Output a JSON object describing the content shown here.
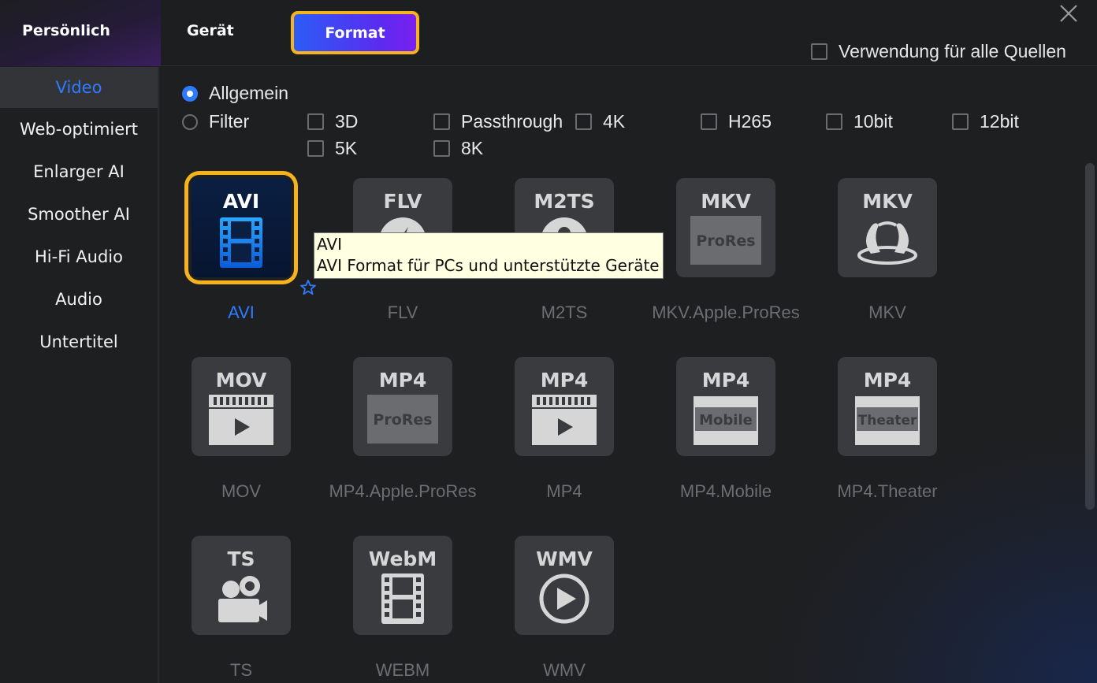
{
  "header": {
    "tabs": [
      {
        "label": "Persönlich"
      },
      {
        "label": "Gerät"
      },
      {
        "label": "Format"
      }
    ],
    "apply_all_label": "Verwendung für alle Quellen"
  },
  "sidebar": {
    "items": [
      {
        "label": "Video"
      },
      {
        "label": "Web-optimiert"
      },
      {
        "label": "Enlarger AI"
      },
      {
        "label": "Smoother AI"
      },
      {
        "label": "Hi-Fi Audio"
      },
      {
        "label": "Audio"
      },
      {
        "label": "Untertitel"
      }
    ]
  },
  "filters": {
    "general_label": "Allgemein",
    "filter_label": "Filter",
    "options": [
      "3D",
      "Passthrough",
      "4K",
      "H265",
      "10bit",
      "12bit",
      "5K",
      "8K"
    ]
  },
  "formats": [
    {
      "label": "AVI",
      "icon_title": "AVI",
      "icon": "film-icon"
    },
    {
      "label": "FLV",
      "icon_title": "FLV",
      "icon": "flash-icon"
    },
    {
      "label": "M2TS",
      "icon_title": "M2TS",
      "icon": "person-icon"
    },
    {
      "label": "MKV.Apple.ProRes",
      "icon_title": "MKV",
      "badge": "ProRes",
      "icon": "prores-icon"
    },
    {
      "label": "MKV",
      "icon_title": "MKV",
      "icon": "vr-icon"
    },
    {
      "label": "MOV",
      "icon_title": "MOV",
      "icon": "clapper-icon"
    },
    {
      "label": "MP4.Apple.ProRes",
      "icon_title": "MP4",
      "badge": "ProRes",
      "icon": "prores-icon"
    },
    {
      "label": "MP4",
      "icon_title": "MP4",
      "icon": "clapper-icon"
    },
    {
      "label": "MP4.Mobile",
      "icon_title": "MP4",
      "badge": "Mobile",
      "icon": "mobile-icon"
    },
    {
      "label": "MP4.Theater",
      "icon_title": "MP4",
      "badge": "Theater",
      "icon": "theater-icon"
    },
    {
      "label": "TS",
      "icon_title": "TS",
      "icon": "camera-icon"
    },
    {
      "label": "WEBM",
      "icon_title": "WebM",
      "icon": "film-icon"
    },
    {
      "label": "WMV",
      "icon_title": "WMV",
      "icon": "play-icon"
    }
  ],
  "tooltip": {
    "title": "AVI",
    "description": "AVI Format für PCs und unterstützte Geräte"
  },
  "colors": {
    "accent": "#2f7bff",
    "highlight": "#f6b31c"
  }
}
